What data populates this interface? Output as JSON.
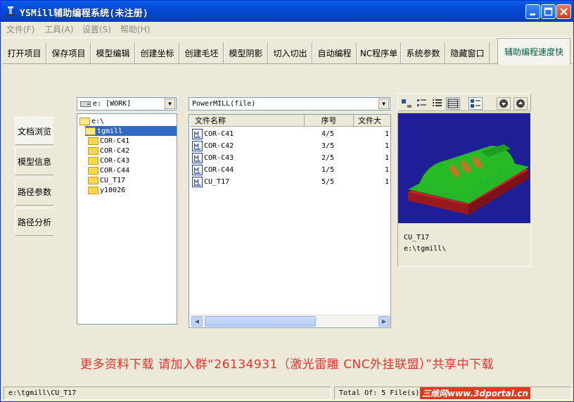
{
  "window": {
    "title": "YSMill辅助编程系统(未注册)"
  },
  "menu": [
    "文件(F)",
    "工具(A)",
    "设置(S)",
    "帮助(H)"
  ],
  "toolbar": {
    "buttons": [
      "打开项目",
      "保存项目",
      "模型编辑",
      "创建坐标",
      "创建毛坯",
      "模型阴影",
      "切入切出",
      "自动编程",
      "NC程序单",
      "系统参数",
      "隐藏窗口"
    ],
    "speed_tab": "辅助编程速度快"
  },
  "sidebar": {
    "tabs": [
      "文档浏览",
      "模型信息",
      "路径参数",
      "路径分析"
    ]
  },
  "drive_combo": {
    "value": "e: [WORK]"
  },
  "filter_combo": {
    "value": "PowerMILL(file)"
  },
  "tree": [
    {
      "label": "e:\\",
      "level": 0
    },
    {
      "label": "tgmill",
      "level": 1,
      "selected": true
    },
    {
      "label": "COR-C41",
      "level": 2
    },
    {
      "label": "COR-C42",
      "level": 2
    },
    {
      "label": "COR-C43",
      "level": 2
    },
    {
      "label": "COR-C44",
      "level": 2
    },
    {
      "label": "CU_T17",
      "level": 2
    },
    {
      "label": "y10026",
      "level": 2
    }
  ],
  "file_list": {
    "headers": {
      "name": "文件名称",
      "seq": "序号",
      "size": "文件大"
    },
    "rows": [
      {
        "name": "COR-C41",
        "seq": "4/5",
        "size": "1"
      },
      {
        "name": "COR-C42",
        "seq": "3/5",
        "size": "1"
      },
      {
        "name": "COR-C43",
        "seq": "2/5",
        "size": "1"
      },
      {
        "name": "COR-C44",
        "seq": "1/5",
        "size": "1"
      },
      {
        "name": "CU_T17",
        "seq": "5/5",
        "size": "1"
      }
    ]
  },
  "preview_info": {
    "name": "CU_T17",
    "path": "e:\\tgmill\\"
  },
  "banner": "更多资料下载 请加入群“26134931（激光雷雕 CNC外挂联盟）”共享中下载",
  "status": {
    "path": "e:\\tgmill\\CU_T17",
    "total": "Total Of: 5 File(s)"
  },
  "watermark": "三维网www.3dportal.cn",
  "colors": {
    "title_bar": "#0549D4",
    "selection": "#316AC5",
    "banner_red": "#E8332E",
    "preview_bg": "#1E1E96",
    "model_green": "#2BC42B",
    "base_red": "#C8202A"
  }
}
